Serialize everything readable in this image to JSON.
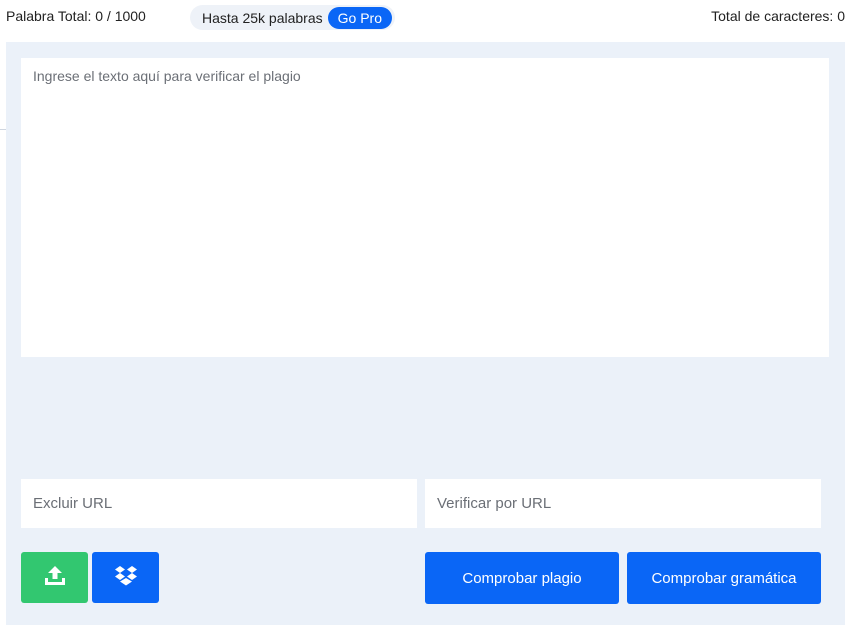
{
  "header": {
    "word_count": "Palabra Total: 0 / 1000",
    "pro_text": "Hasta 25k palabras",
    "go_pro_label": "Go Pro",
    "char_count": "Total de caracteres: 0"
  },
  "editor": {
    "placeholder": "Ingrese el texto aquí para verificar el plagio",
    "value": ""
  },
  "url_fields": {
    "exclude_placeholder": "Excluir URL",
    "verify_placeholder": "Verificar por URL"
  },
  "actions": {
    "upload_icon": "upload-icon",
    "dropbox_icon": "dropbox-icon",
    "check_plagiarism_label": "Comprobar plagio",
    "check_grammar_label": "Comprobar gramática"
  },
  "colors": {
    "accent": "#0a66f6",
    "upload_green": "#32c770",
    "panel_bg": "#ebf1f9"
  }
}
